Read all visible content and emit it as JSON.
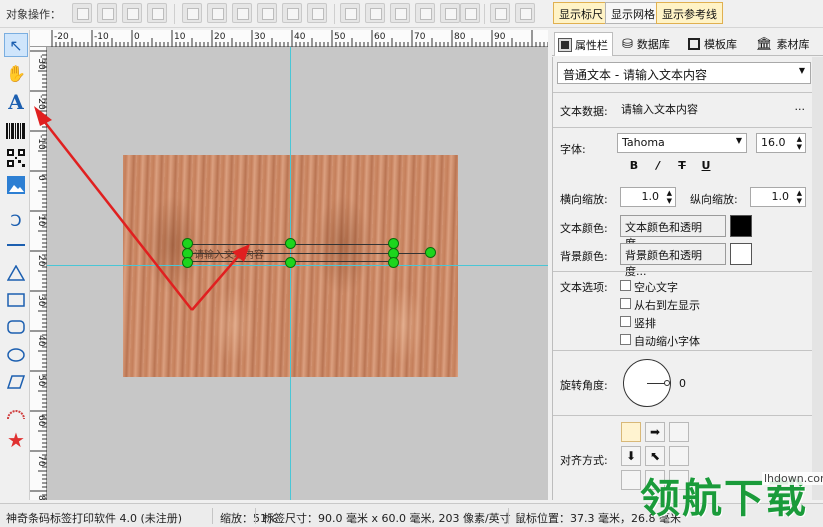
{
  "toolbar": {
    "object_ops_label": "对象操作：",
    "show_ruler": "显示标尺",
    "show_grid": "显示网格",
    "show_guides": "显示参考线"
  },
  "left_tools": [
    {
      "name": "select-arrow-icon"
    },
    {
      "name": "pan-hand-icon"
    },
    {
      "name": "text-icon"
    },
    {
      "name": "barcode-icon"
    },
    {
      "name": "qrcode-icon"
    },
    {
      "name": "image-icon"
    },
    {
      "name": "curve-icon"
    },
    {
      "name": "line-icon"
    },
    {
      "name": "triangle-icon"
    },
    {
      "name": "rectangle-icon"
    },
    {
      "name": "rounded-rect-icon"
    },
    {
      "name": "ellipse-icon"
    },
    {
      "name": "parallelogram-icon"
    },
    {
      "name": "arc-icon"
    },
    {
      "name": "star-icon"
    }
  ],
  "ruler_top": [
    "-20",
    "-10",
    "0",
    "10",
    "20",
    "30",
    "40",
    "50",
    "60",
    "70",
    "80",
    "90"
  ],
  "ruler_left": [
    "-30",
    "-20",
    "-10",
    "0",
    "10",
    "20",
    "30",
    "40",
    "50",
    "60",
    "70",
    "80",
    "90"
  ],
  "canvas": {
    "object_text": "请输入文本内容"
  },
  "tabs": {
    "properties": "属性栏",
    "database": "数据库",
    "templates": "模板库",
    "assets": "素材库"
  },
  "panel": {
    "object_type": "普通文本 - 请输入文本内容",
    "text_data_label": "文本数据:",
    "text_data_value": "请输入文本内容",
    "more_button": "...",
    "font_label": "字体:",
    "font_value": "Tahoma",
    "font_size": "16.0",
    "format_bold": "B",
    "format_italic": "/",
    "format_strike": "T",
    "format_underline": "U",
    "hscale_label": "横向缩放:",
    "hscale_value": "1.0",
    "vscale_label": "纵向缩放:",
    "vscale_value": "1.0",
    "text_color_label": "文本颜色:",
    "text_color_button": "文本颜色和透明度...",
    "text_color": "#000000",
    "bg_color_label": "背景颜色:",
    "bg_color_button": "背景颜色和透明度...",
    "bg_color": "#ffffff",
    "text_options_label": "文本选项:",
    "options": [
      "空心文字",
      "从右到左显示",
      "竖排",
      "自动缩小字体"
    ],
    "rotation_label": "旋转角度:",
    "rotation_value": "0",
    "align_label": "对齐方式:"
  },
  "status": {
    "app": "神奇条码标签打印软件 4.0 (未注册)",
    "zoom": "缩放：51%",
    "label_size": "标签尺寸：90.0 毫米 x 60.0 毫米, 203 像素/英寸",
    "mouse_pos": "鼠标位置：37.3 毫米，26.8 毫米"
  },
  "watermark": {
    "text": "领航下载",
    "domain": "lhdown.com"
  },
  "colors": {
    "handle": "#1dd51d",
    "guide": "#49c6d6",
    "annotation_arrow": "#e02020"
  }
}
